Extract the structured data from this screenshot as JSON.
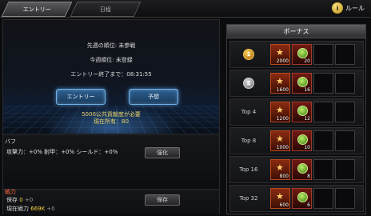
{
  "tabs": {
    "entry": "エントリー",
    "history": "日程"
  },
  "rules_label": "ルール",
  "rules_badge": "i",
  "hero": {
    "prev_rank": "先週の順位: 未参戦",
    "curr_rank": "今週順位: 未登録",
    "timer": "エントリー終了まで：08:31:55",
    "entry_button": "エントリー",
    "prev_button": "予想",
    "requirement": "5000公共貢献度が必要",
    "owned": "現在所有：80"
  },
  "buff": {
    "title": "バフ",
    "line": "攻撃力：+0%  耐甲：+0%  シールド：+0%",
    "button": "強化"
  },
  "power": {
    "title": "戦力",
    "saved_label": "保存",
    "saved_value": "0",
    "saved_dim": "+0",
    "current_label": "現在戦力",
    "current_value": "669K",
    "current_dim": "+0",
    "button": "保存"
  },
  "bonus": {
    "title": "ボーナス",
    "rows": [
      {
        "rank": "",
        "medal": "gold",
        "medal_text": "1",
        "item_qty": "2000",
        "coin_qty": "20"
      },
      {
        "rank": "",
        "medal": "silver",
        "medal_text": "2",
        "item_qty": "1600",
        "coin_qty": "16"
      },
      {
        "rank": "Top 4",
        "medal": "",
        "medal_text": "",
        "item_qty": "1200",
        "coin_qty": "12"
      },
      {
        "rank": "Top 8",
        "medal": "",
        "medal_text": "",
        "item_qty": "1000",
        "coin_qty": "10"
      },
      {
        "rank": "Top 16",
        "medal": "",
        "medal_text": "",
        "item_qty": "800",
        "coin_qty": "8"
      },
      {
        "rank": "Top 32",
        "medal": "",
        "medal_text": "",
        "item_qty": "600",
        "coin_qty": "6"
      }
    ]
  },
  "colors": {
    "accent_blue": "#6fb0e6",
    "power_red": "#ff6a3d",
    "gold_text": "#f3d23a"
  }
}
